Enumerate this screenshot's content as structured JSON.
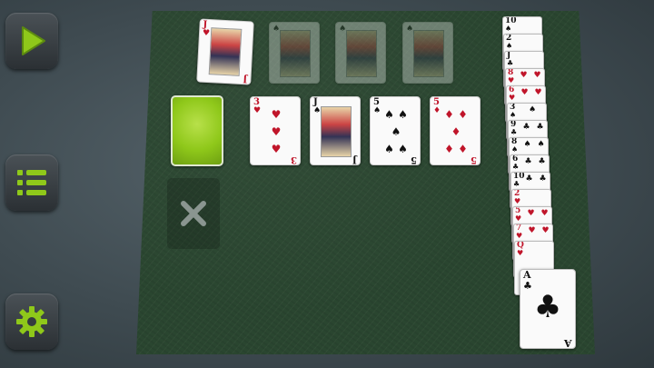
{
  "buttons": {
    "play_icon": "play-icon",
    "menu_icon": "list-icon",
    "settings_icon": "gear-icon"
  },
  "accent_color": "#8fc81a",
  "foundation": [
    {
      "rank": "J",
      "suit": "♥",
      "color": "red",
      "faded": false
    },
    {
      "rank": "",
      "suit": "♠",
      "color": "blk",
      "faded": true
    },
    {
      "rank": "",
      "suit": "♠",
      "color": "blk",
      "faded": true
    },
    {
      "rank": "",
      "suit": "♠",
      "color": "blk",
      "faded": true
    }
  ],
  "tableau_row": [
    {
      "rank": "3",
      "suit": "♥",
      "color": "red"
    },
    {
      "rank": "J",
      "suit": "♠",
      "color": "blk"
    },
    {
      "rank": "5",
      "suit": "♠",
      "color": "blk"
    },
    {
      "rank": "5",
      "suit": "♦",
      "color": "red"
    }
  ],
  "waste_icon": "x-icon",
  "column": [
    {
      "rank": "10",
      "suit": "♠",
      "color": "blk"
    },
    {
      "rank": "2",
      "suit": "♠",
      "color": "blk"
    },
    {
      "rank": "J",
      "suit": "♣",
      "color": "blk"
    },
    {
      "rank": "8",
      "suit": "♥",
      "color": "red"
    },
    {
      "rank": "6",
      "suit": "♥",
      "color": "red"
    },
    {
      "rank": "3",
      "suit": "♠",
      "color": "blk"
    },
    {
      "rank": "9",
      "suit": "♣",
      "color": "blk"
    },
    {
      "rank": "8",
      "suit": "♠",
      "color": "blk"
    },
    {
      "rank": "6",
      "suit": "♣",
      "color": "blk"
    },
    {
      "rank": "10",
      "suit": "♣",
      "color": "blk"
    },
    {
      "rank": "2",
      "suit": "♥",
      "color": "red"
    },
    {
      "rank": "5",
      "suit": "♥",
      "color": "red"
    },
    {
      "rank": "7",
      "suit": "♥",
      "color": "red"
    },
    {
      "rank": "Q",
      "suit": "♥",
      "color": "red"
    }
  ],
  "last_card": {
    "rank": "A",
    "suit": "♣",
    "color": "blk"
  }
}
